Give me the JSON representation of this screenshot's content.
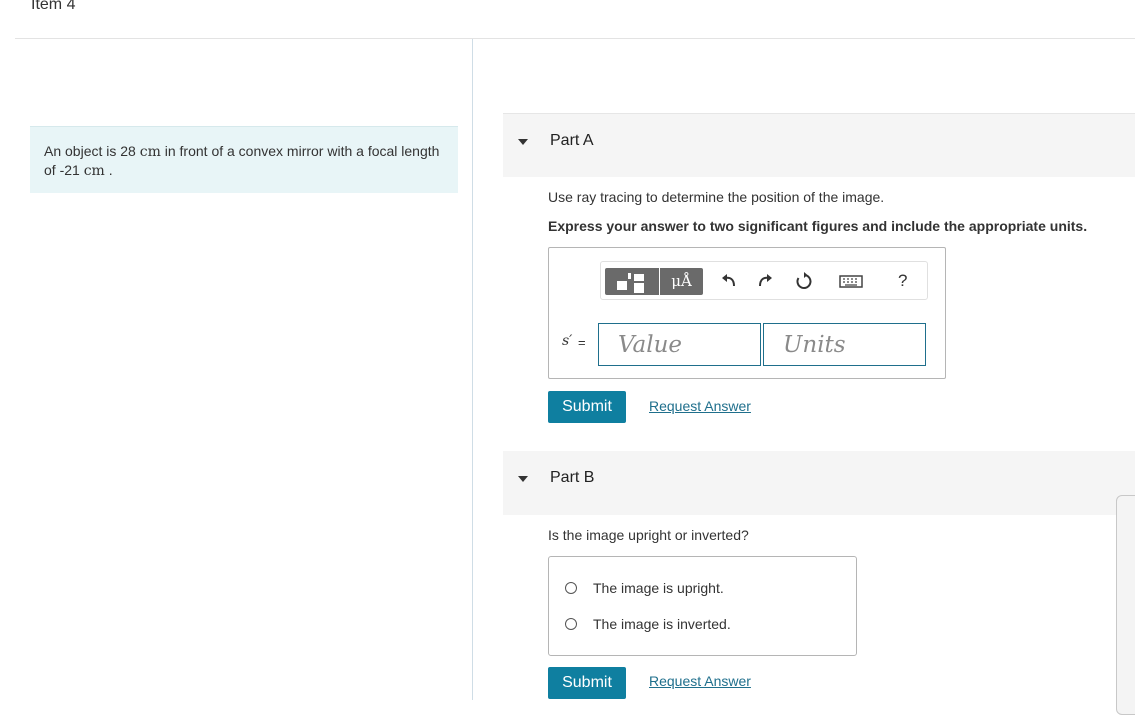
{
  "item": {
    "title": "Item 4"
  },
  "problem": {
    "text_1": "An object is 28 ",
    "unit_1": "cm",
    "text_2": " in front of a convex mirror with a focal length of -21 ",
    "unit_2": "cm",
    "text_3": " ."
  },
  "part_a": {
    "title": "Part A",
    "prompt": "Use ray tracing to determine the position of the image.",
    "instruction": "Express your answer to two significant figures and include the appropriate units.",
    "toolbar": {
      "templates_icon": "templates-icon",
      "units_label": "μÅ",
      "undo_icon": "undo-icon",
      "redo_icon": "redo-icon",
      "reset_icon": "reset-icon",
      "keyboard_icon": "keyboard-icon",
      "help_label": "?"
    },
    "variable_label": "s′",
    "equals": "=",
    "value_placeholder": "Value",
    "units_placeholder": "Units",
    "submit_label": "Submit",
    "request_label": "Request Answer"
  },
  "part_b": {
    "title": "Part B",
    "prompt": "Is the image upright or inverted?",
    "options": [
      "The image is upright.",
      "The image is inverted."
    ],
    "submit_label": "Submit",
    "request_label": "Request Answer"
  },
  "colors": {
    "accent": "#0f7fa0",
    "link": "#1f6f8c",
    "problem_bg": "#e8f5f7",
    "part_header_bg": "#f5f5f5"
  }
}
